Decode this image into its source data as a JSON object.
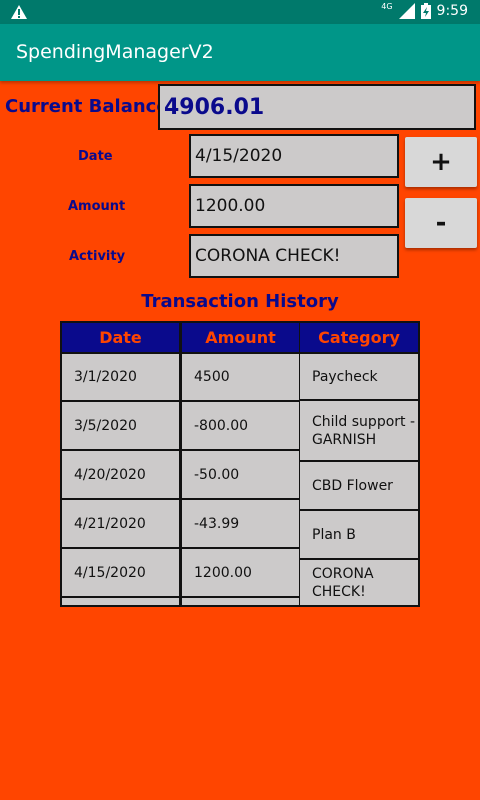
{
  "status_bar": {
    "network": "4G",
    "time": "9:59"
  },
  "app": {
    "title": "SpendingManagerV2"
  },
  "balance": {
    "label": "Current Balance:",
    "value": "4906.01"
  },
  "form": {
    "date_label": "Date",
    "date_value": "4/15/2020",
    "amount_label": "Amount",
    "amount_value": "1200.00",
    "activity_label": "Activity",
    "activity_value": "CORONA CHECK!"
  },
  "buttons": {
    "add": "+",
    "subtract": "-"
  },
  "history": {
    "title": "Transaction History",
    "headers": [
      "Date",
      "Amount",
      "Category"
    ],
    "rows": [
      {
        "date": "3/1/2020",
        "amount": "4500",
        "category": "Paycheck"
      },
      {
        "date": "3/5/2020",
        "amount": "-800.00",
        "category": "Child support - GARNISH"
      },
      {
        "date": "4/20/2020",
        "amount": "-50.00",
        "category": "CBD Flower"
      },
      {
        "date": "4/21/2020",
        "amount": "-43.99",
        "category": "Plan B"
      },
      {
        "date": "4/15/2020",
        "amount": "1200.00",
        "category": "CORONA CHECK!"
      }
    ]
  },
  "colors": {
    "background": "#FF4500",
    "app_bar": "#009688",
    "status_bar": "#00796B",
    "text_dark_blue": "#0A0A8C",
    "field_bg": "#CCCACA"
  }
}
